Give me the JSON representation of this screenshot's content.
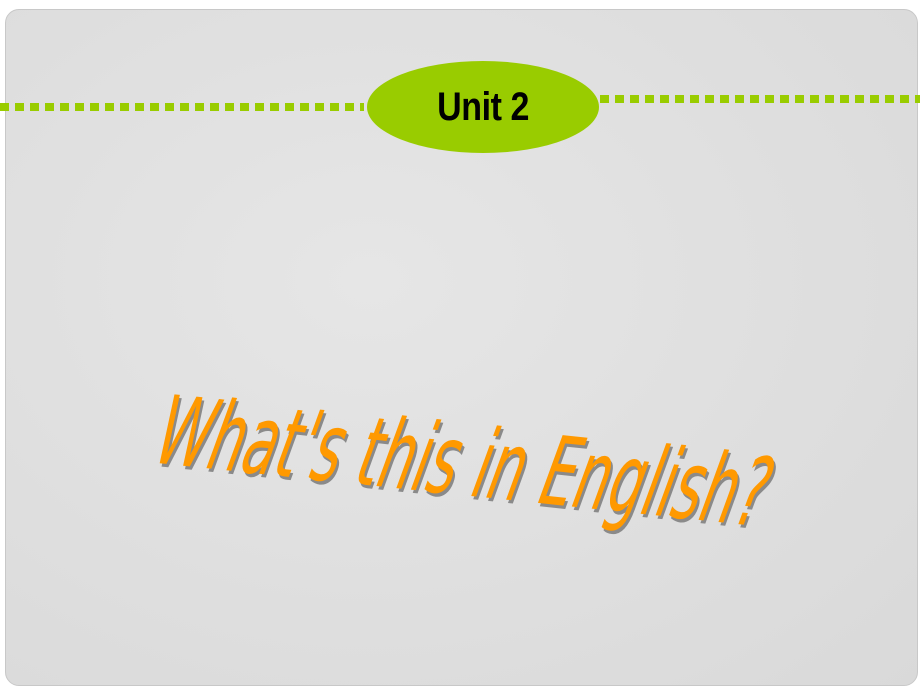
{
  "slide": {
    "unit_label": "Unit 2",
    "title": "What's this in English?",
    "colors": {
      "accent_green": "#99cc00",
      "title_orange": "#ff9900",
      "title_shadow": "#8a8a8a",
      "panel_background": "#dedede"
    }
  }
}
